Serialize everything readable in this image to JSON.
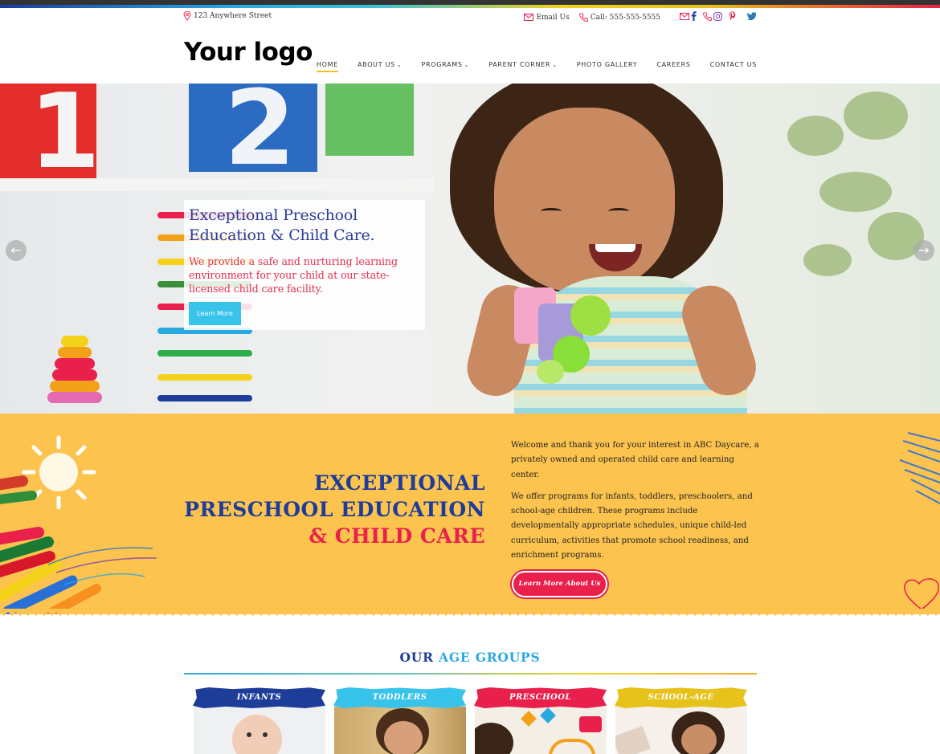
{
  "topbar": {
    "address": "123 Anywhere Street",
    "email_label": "Email Us",
    "phone_label": "Call: 555-555-5555",
    "social_icons": [
      "email-icon",
      "facebook-icon",
      "phone-icon",
      "instagram-icon",
      "pinterest-icon",
      "twitter-icon"
    ]
  },
  "header": {
    "logo": "Your logo",
    "nav": [
      {
        "label": "HOME",
        "active": true
      },
      {
        "label": "ABOUT US",
        "dropdown": true
      },
      {
        "label": "PROGRAMS",
        "dropdown": true
      },
      {
        "label": "PARENT CORNER",
        "dropdown": true
      },
      {
        "label": "PHOTO GALLERY"
      },
      {
        "label": "CAREERS"
      },
      {
        "label": "CONTACT US"
      }
    ]
  },
  "hero": {
    "title_line1": "Exceptional Preschool",
    "title_line2": "Education & Child Care.",
    "text": "We provide a safe and nurturing learning environment for your child at our state-licensed child care facility.",
    "button": "Learn More",
    "slide_block_1": "1",
    "slide_block_2": "2"
  },
  "welcome": {
    "heading_line1": "EXCEPTIONAL",
    "heading_line2": "PRESCHOOL EDUCATION",
    "heading_line3": "& CHILD CARE",
    "para1": "Welcome and thank you for your interest in ABC Daycare, a privately owned and operated child care and learning center.",
    "para2": "We offer programs for infants, toddlers, preschoolers, and school-age children. These programs include developmentally appropriate schedules, unique child-led curriculum, activities that promote school readiness, and enrichment programs.",
    "button": "Learn More About Us"
  },
  "age_groups": {
    "title_part1": "OUR",
    "title_part2": "AGE GROUPS",
    "items": [
      {
        "label": "INFANTS",
        "color": "#1d3d99"
      },
      {
        "label": "TODDLERS",
        "color": "#38c3eb"
      },
      {
        "label": "PRESCHOOL",
        "color": "#e8204b"
      },
      {
        "label": "SCHOOL-AGE",
        "color": "#e6c21a"
      }
    ]
  },
  "colors": {
    "navy": "#1d3d99",
    "sky": "#38c3eb",
    "red": "#e8204b",
    "yellow": "#fcc34f"
  }
}
